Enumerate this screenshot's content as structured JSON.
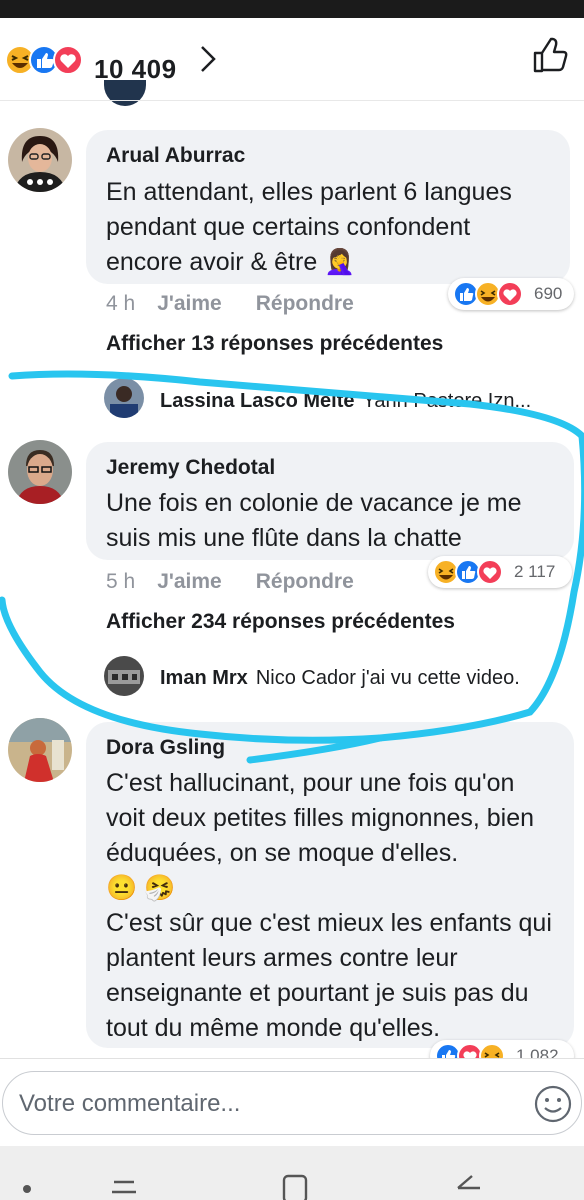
{
  "reactions_bar": {
    "total": "10 409",
    "icons": [
      "haha-icon",
      "like-icon",
      "love-icon"
    ]
  },
  "comments": [
    {
      "author": "Arual Aburrac",
      "text": "En attendant, elles parlent 6 langues pendant que certains confondent encore avoir & être 🤦‍♀️",
      "time": "4 h",
      "like_label": "J'aime",
      "reply_label": "Répondre",
      "reaction_count": "690",
      "prev_replies": "Afficher 13 réponses précédentes",
      "last_reply_author": "Lassina Lasco Meite",
      "last_reply_text": "Yann Pastore Izn..."
    },
    {
      "author": "Jeremy Chedotal",
      "text": "Une fois en colonie de vacance je me suis mis une flûte dans la chatte",
      "time": "5 h",
      "like_label": "J'aime",
      "reply_label": "Répondre",
      "reaction_count": "2 117",
      "prev_replies": "Afficher 234 réponses précédentes",
      "last_reply_author": "Iman Mrx",
      "last_reply_text": "Nico Cador j'ai vu cette video."
    },
    {
      "author": "Dora Gsling",
      "text_p1": "C'est hallucinant, pour une fois qu'on voit deux petites filles mignonnes, bien éduquées, on se moque d'elles.",
      "text_emoji": "😐 🤧",
      "text_p2": "C'est sûr que c'est mieux les enfants qui plantent leurs armes contre leur enseignante et pourtant je suis pas du tout du même monde qu'elles.",
      "reaction_count": "1 082"
    }
  ],
  "composer": {
    "placeholder": "Votre commentaire..."
  },
  "colors": {
    "bubble": "#f0f2f5",
    "meta_gray": "#90949c",
    "like_blue": "#1877f2",
    "love_red": "#f33e58",
    "haha_yellow": "#f7b125",
    "marker_cyan": "#29c5ef"
  }
}
